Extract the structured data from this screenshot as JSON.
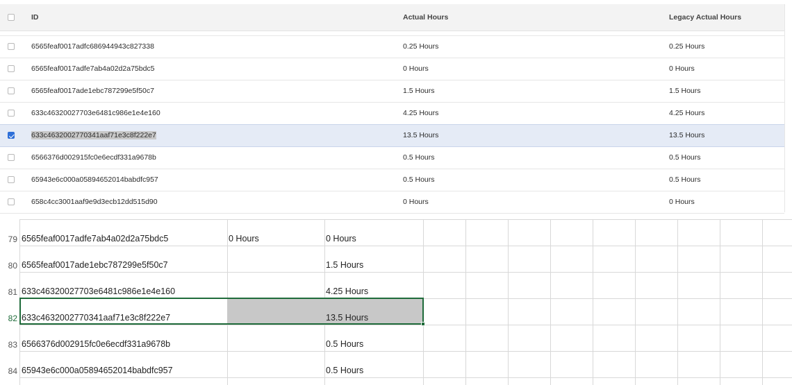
{
  "web_grid": {
    "columns": {
      "id": "ID",
      "actual": "Actual Hours",
      "legacy": "Legacy Actual Hours"
    },
    "rows": [
      {
        "id": "6565feaf0017adfc686944943c827338",
        "actual": "0.25 Hours",
        "legacy": "0.25 Hours",
        "checked": false
      },
      {
        "id": "6565feaf0017adfe7ab4a02d2a75bdc5",
        "actual": "0 Hours",
        "legacy": "0 Hours",
        "checked": false
      },
      {
        "id": "6565feaf0017ade1ebc787299e5f50c7",
        "actual": "1.5 Hours",
        "legacy": "1.5 Hours",
        "checked": false
      },
      {
        "id": "633c46320027703e6481c986e1e4e160",
        "actual": "4.25 Hours",
        "legacy": "4.25 Hours",
        "checked": false
      },
      {
        "id": "633c4632002770341aaf71e3c8f222e7",
        "actual": "13.5 Hours",
        "legacy": "13.5 Hours",
        "checked": true
      },
      {
        "id": "6566376d002915fc0e6ecdf331a9678b",
        "actual": "0.5 Hours",
        "legacy": "0.5 Hours",
        "checked": false
      },
      {
        "id": "65943e6c000a05894652014babdfc957",
        "actual": "0.5 Hours",
        "legacy": "0.5 Hours",
        "checked": false
      },
      {
        "id": "658c4cc3001aaf9e9d3ecb12dd515d90",
        "actual": "0 Hours",
        "legacy": "0 Hours",
        "checked": false
      }
    ]
  },
  "sheet": {
    "rows": [
      {
        "num": "79",
        "a": "6565feaf0017adfe7ab4a02d2a75bdc5",
        "b": "0 Hours",
        "c": "0 Hours"
      },
      {
        "num": "80",
        "a": "6565feaf0017ade1ebc787299e5f50c7",
        "b": "",
        "c": "1.5 Hours"
      },
      {
        "num": "81",
        "a": "633c46320027703e6481c986e1e4e160",
        "b": "",
        "c": "4.25 Hours"
      },
      {
        "num": "82",
        "a": "633c4632002770341aaf71e3c8f222e7",
        "b": "",
        "c": "13.5 Hours"
      },
      {
        "num": "83",
        "a": "6566376d002915fc0e6ecdf331a9678b",
        "b": "",
        "c": "0.5 Hours"
      },
      {
        "num": "84",
        "a": "65943e6c000a05894652014babdfc957",
        "b": "",
        "c": "0.5 Hours"
      }
    ]
  },
  "colors": {
    "selection_border": "#1f6b3a",
    "selected_row": "#e5ebf6",
    "checkbox_checked": "#2e6fd8"
  }
}
